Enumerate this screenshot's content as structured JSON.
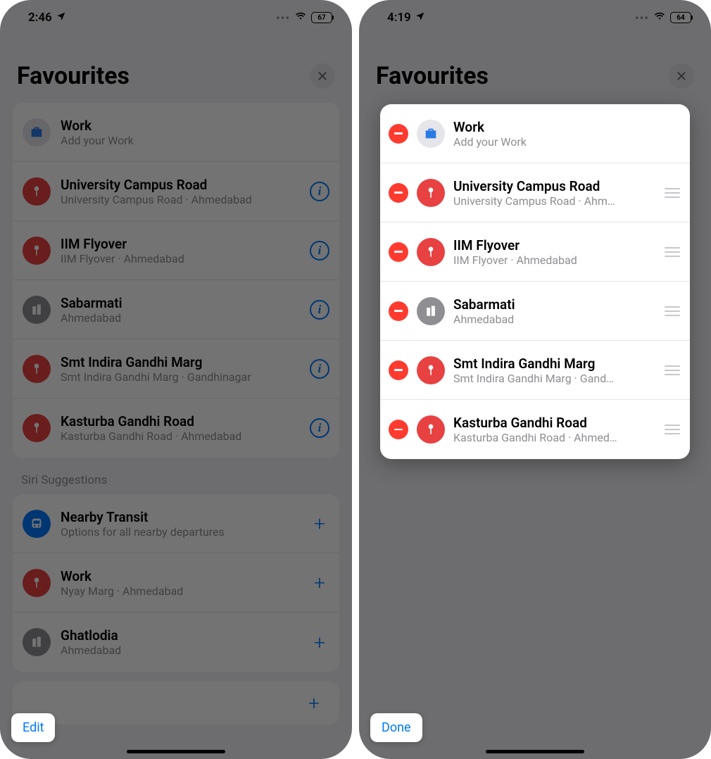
{
  "left": {
    "status": {
      "time": "2:46",
      "battery": "67"
    },
    "title": "Favourites",
    "favourites": [
      {
        "title": "Work",
        "sub": "Add your Work",
        "icon": "briefcase",
        "color": "gray-light",
        "info": false
      },
      {
        "title": "University Campus Road",
        "sub": "University Campus Road · Ahmedabad",
        "icon": "pin",
        "color": "red",
        "info": true
      },
      {
        "title": "IIM Flyover",
        "sub": "IIM Flyover · Ahmedabad",
        "icon": "pin",
        "color": "red",
        "info": true
      },
      {
        "title": "Sabarmati",
        "sub": "Ahmedabad",
        "icon": "building",
        "color": "gray",
        "info": true
      },
      {
        "title": "Smt Indira Gandhi Marg",
        "sub": "Smt Indira Gandhi Marg · Gandhinagar",
        "icon": "pin",
        "color": "red",
        "info": true
      },
      {
        "title": "Kasturba Gandhi Road",
        "sub": "Kasturba Gandhi Road · Ahmedabad",
        "icon": "pin",
        "color": "red",
        "info": true
      }
    ],
    "siri_label": "Siri Suggestions",
    "suggestions": [
      {
        "title": "Nearby Transit",
        "sub": "Options for all nearby departures",
        "icon": "transit",
        "color": "blue"
      },
      {
        "title": "Work",
        "sub": "Nyay Marg · Ahmedabad",
        "icon": "pin",
        "color": "red"
      },
      {
        "title": "Ghatlodia",
        "sub": "Ahmedabad",
        "icon": "building",
        "color": "gray"
      }
    ],
    "footer_button": "Edit"
  },
  "right": {
    "status": {
      "time": "4:19",
      "battery": "64"
    },
    "title": "Favourites",
    "favourites": [
      {
        "title": "Work",
        "sub": "Add your Work",
        "icon": "briefcase",
        "color": "gray-light",
        "drag": false
      },
      {
        "title": "University Campus Road",
        "sub": "University Campus Road · Ahm…",
        "icon": "pin",
        "color": "red",
        "drag": true
      },
      {
        "title": "IIM Flyover",
        "sub": "IIM Flyover · Ahmedabad",
        "icon": "pin",
        "color": "red",
        "drag": true
      },
      {
        "title": "Sabarmati",
        "sub": "Ahmedabad",
        "icon": "building",
        "color": "gray",
        "drag": true
      },
      {
        "title": "Smt Indira Gandhi Marg",
        "sub": "Smt Indira Gandhi Marg · Gand…",
        "icon": "pin",
        "color": "red",
        "drag": true
      },
      {
        "title": "Kasturba Gandhi Road",
        "sub": "Kasturba Gandhi Road · Ahmed…",
        "icon": "pin",
        "color": "red",
        "drag": true
      }
    ],
    "footer_button": "Done"
  },
  "icons": {
    "briefcase": "💼",
    "pin": "📍",
    "building": "🏙",
    "transit": "🚌"
  }
}
